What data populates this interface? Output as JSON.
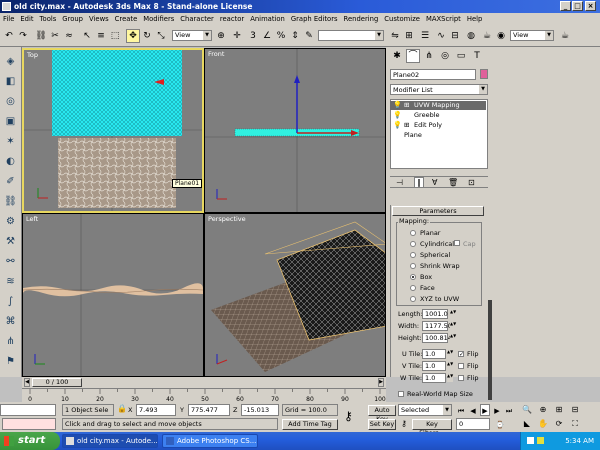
{
  "window": {
    "title": "old city.max - Autodesk 3ds Max 8  - Stand-alone License"
  },
  "menu": [
    "File",
    "Edit",
    "Tools",
    "Group",
    "Views",
    "Create",
    "Modifiers",
    "Character",
    "reactor",
    "Animation",
    "Graph Editors",
    "Rendering",
    "Customize",
    "MAXScript",
    "Help"
  ],
  "toolbar": {
    "view_combo": "View",
    "view_combo2": "View",
    "selection_set": ""
  },
  "viewports": {
    "top": {
      "label": "Top",
      "tooltip": "Plane01"
    },
    "front": {
      "label": "Front"
    },
    "left": {
      "label": "Left"
    },
    "perspective": {
      "label": "Perspective"
    }
  },
  "command_panel": {
    "object_name": "Plane02",
    "object_color": "#e0609a",
    "modifier_list": "Modifier List",
    "stack": [
      "UVW Mapping",
      "Greeble",
      "Edit Poly",
      "Plane"
    ],
    "rollout_title": "Parameters",
    "mapping_label": "Mapping:",
    "mapping_options": [
      "Planar",
      "Cylindrical",
      "Spherical",
      "Shrink Wrap",
      "Box",
      "Face",
      "XYZ to UVW"
    ],
    "mapping_selected": "Box",
    "cap_label": "Cap",
    "length_label": "Length:",
    "length_value": "1001.0",
    "width_label": "Width:",
    "width_value": "1177.50",
    "height_label": "Height:",
    "height_value": "100.814",
    "utile_label": "U Tile:",
    "utile_value": "1.0",
    "vtile_label": "V Tile:",
    "vtile_value": "1.0",
    "wtile_label": "W Tile:",
    "wtile_value": "1.0",
    "flip_label": "Flip",
    "realworld_label": "Real-World Map Size"
  },
  "timeline": {
    "frame": "0 / 100",
    "ticks": [
      "0",
      "10",
      "20",
      "30",
      "40",
      "50",
      "60",
      "70",
      "80",
      "90",
      "100"
    ]
  },
  "status": {
    "selection": "1 Object Sele",
    "prompt": "Click and drag to select and move objects",
    "x_label": "X",
    "x_value": "7.493",
    "y_label": "Y",
    "y_value": "775.477",
    "z_label": "Z",
    "z_value": "-15.013",
    "grid": "Grid = 100.0",
    "add_time_tag": "Add Time Tag",
    "auto_key": "Auto Key",
    "set_key": "Set Key",
    "key_filters": "Key Filters...",
    "selected_combo": "Selected",
    "frame_field": "0"
  },
  "taskbar": {
    "start": "start",
    "tasks": [
      "old city.max - Autode...",
      "Adobe Photoshop CS..."
    ],
    "clock": "5:34 AM"
  }
}
